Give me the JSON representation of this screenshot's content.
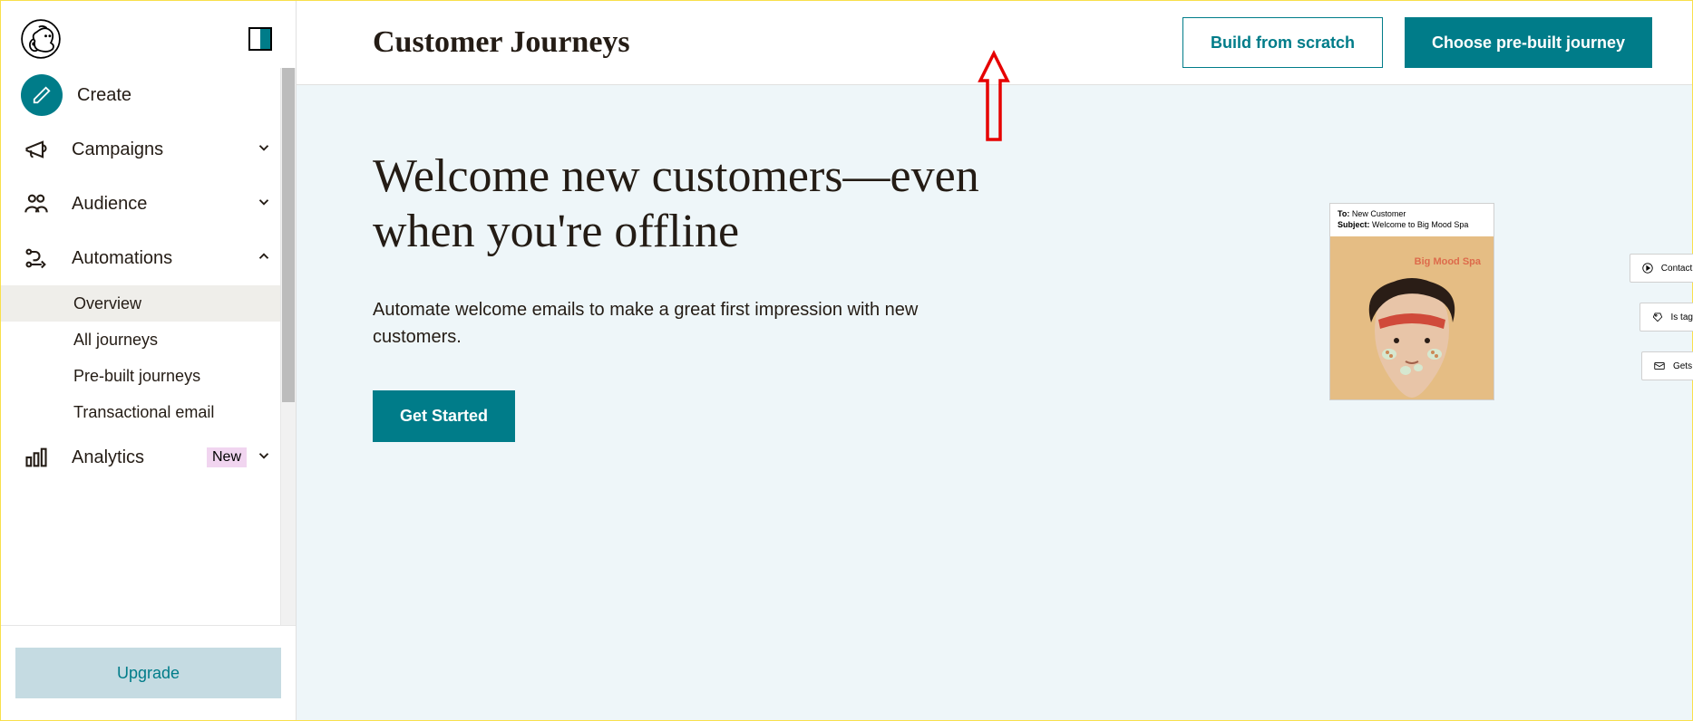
{
  "sidebar": {
    "create_label": "Create",
    "items": [
      {
        "icon": "megaphone-icon",
        "label": "Campaigns",
        "chev": "down"
      },
      {
        "icon": "people-icon",
        "label": "Audience",
        "chev": "down"
      },
      {
        "icon": "automations-icon",
        "label": "Automations",
        "chev": "up"
      },
      {
        "icon": "analytics-icon",
        "label": "Analytics",
        "chev": "down",
        "badge": "New"
      }
    ],
    "automations_sub": [
      {
        "label": "Overview",
        "active": true
      },
      {
        "label": "All journeys",
        "active": false
      },
      {
        "label": "Pre-built journeys",
        "active": false
      },
      {
        "label": "Transactional email",
        "active": false
      }
    ],
    "upgrade_label": "Upgrade"
  },
  "header": {
    "title": "Customer Journeys",
    "build_btn": "Build from scratch",
    "choose_btn": "Choose pre-built journey"
  },
  "hero": {
    "title": "Welcome new customers—even when you're offline",
    "subtitle": "Automate welcome emails to make a great first impression with new customers.",
    "cta": "Get Started"
  },
  "illustration": {
    "to_label": "To:",
    "to_value": "New Customer",
    "subject_label": "Subject:",
    "subject_value": "Welcome to Big Mood Spa",
    "brand": "Big Mood Spa",
    "step1": "Contact signs up to your audience",
    "step2": "Is tagged as \"New Customer\"",
    "step3": "Gets welcome email"
  },
  "colors": {
    "accent": "#007c89"
  }
}
